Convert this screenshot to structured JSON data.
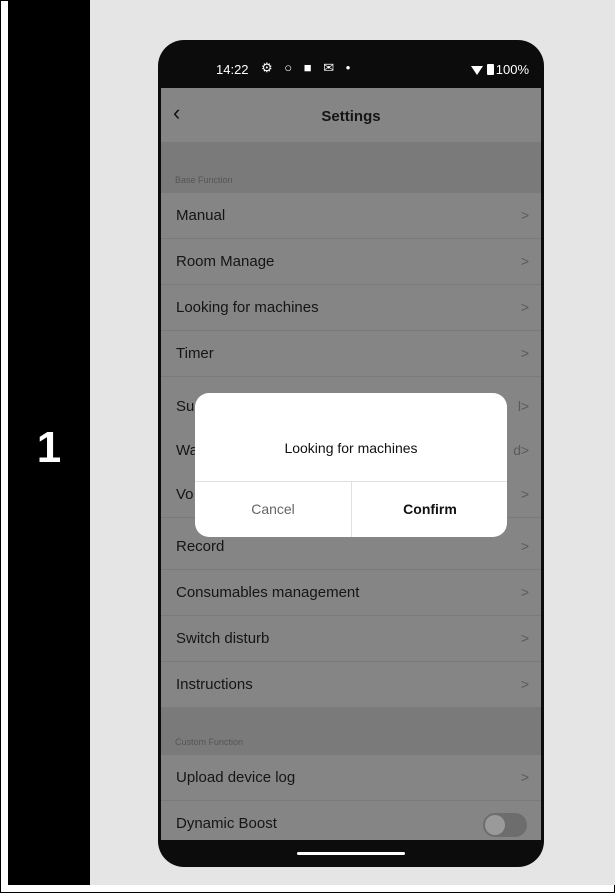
{
  "step": {
    "number": "1"
  },
  "statusbar": {
    "time": "14:22",
    "icons": "⚙ ○ ■ ✉ •",
    "battery": "100%"
  },
  "header": {
    "title": "Settings"
  },
  "sections": {
    "base": "Base Function",
    "custom": "Custom Function"
  },
  "rows": [
    {
      "label": "Manual"
    },
    {
      "label": "Room Manage"
    },
    {
      "label": "Looking for machines"
    },
    {
      "label": "Timer"
    },
    {
      "label": "Su",
      "value": "l"
    },
    {
      "label": "Wa",
      "value": "d"
    },
    {
      "label": "Vo"
    },
    {
      "label": "Record"
    },
    {
      "label": "Consumables management"
    },
    {
      "label": "Switch disturb"
    },
    {
      "label": "Instructions"
    }
  ],
  "custom_rows": [
    {
      "label": "Upload device log"
    },
    {
      "label": "Dynamic Boost"
    }
  ],
  "dialog": {
    "message": "Looking for machines",
    "cancel": "Cancel",
    "confirm": "Confirm"
  }
}
